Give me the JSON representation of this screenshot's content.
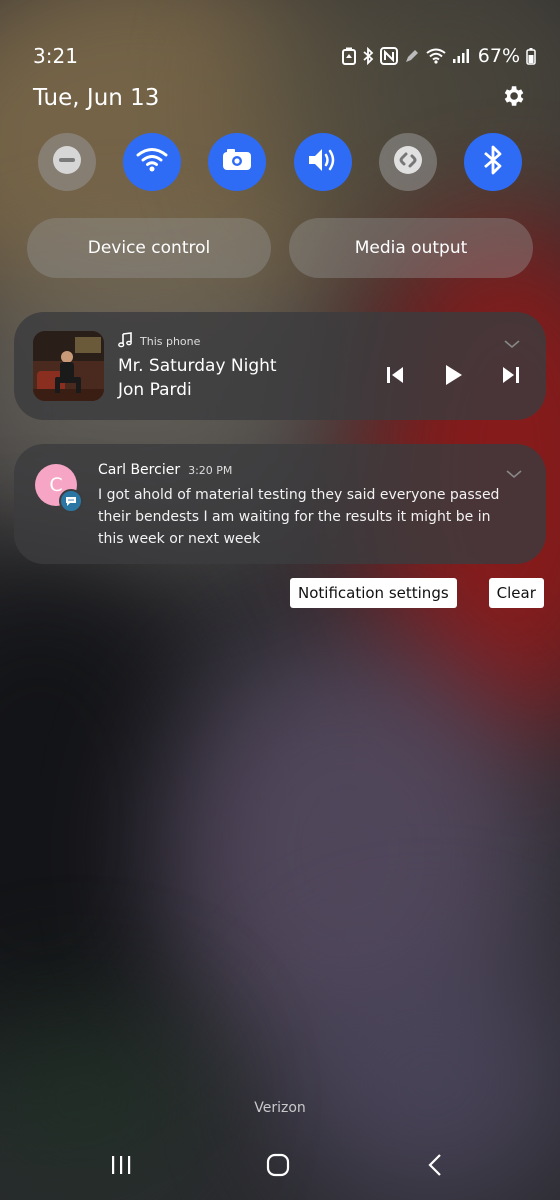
{
  "status_bar": {
    "time": "3:21",
    "icons": [
      "battery-saver-icon",
      "bluetooth-icon",
      "nfc-icon",
      "pen-icon",
      "wifi-icon",
      "signal-icon"
    ],
    "battery": "67%"
  },
  "header": {
    "date": "Tue, Jun 13",
    "settings_icon": "gear-icon"
  },
  "quick_tiles": [
    {
      "name": "do-not-disturb",
      "icon": "minus-circle-icon",
      "state": "off"
    },
    {
      "name": "wifi",
      "icon": "wifi-icon",
      "state": "on"
    },
    {
      "name": "screen-recorder",
      "icon": "camera-icon",
      "state": "on"
    },
    {
      "name": "sound",
      "icon": "volume-icon",
      "state": "on"
    },
    {
      "name": "shazam",
      "icon": "shazam-icon",
      "state": "off"
    },
    {
      "name": "bluetooth",
      "icon": "bluetooth-icon",
      "state": "on"
    }
  ],
  "panel_buttons": {
    "device_control": "Device control",
    "media_output": "Media output"
  },
  "media": {
    "source": "This phone",
    "title": "Mr. Saturday Night",
    "artist": "Jon Pardi",
    "controls": [
      "previous-icon",
      "play-icon",
      "next-icon"
    ]
  },
  "message": {
    "avatar_letter": "C",
    "sender": "Carl Bercier",
    "time": "3:20 PM",
    "body": "I got ahold of material testing they said everyone passed their bendests I am waiting for the results it might be in this week or next week"
  },
  "notification_actions": {
    "settings": "Notification settings",
    "clear": "Clear"
  },
  "carrier": "Verizon",
  "colors": {
    "accent": "#2e6cf6",
    "tile_off": "#8a8a8a",
    "avatar": "#f6a5c4",
    "badge": "#2b77a4"
  }
}
